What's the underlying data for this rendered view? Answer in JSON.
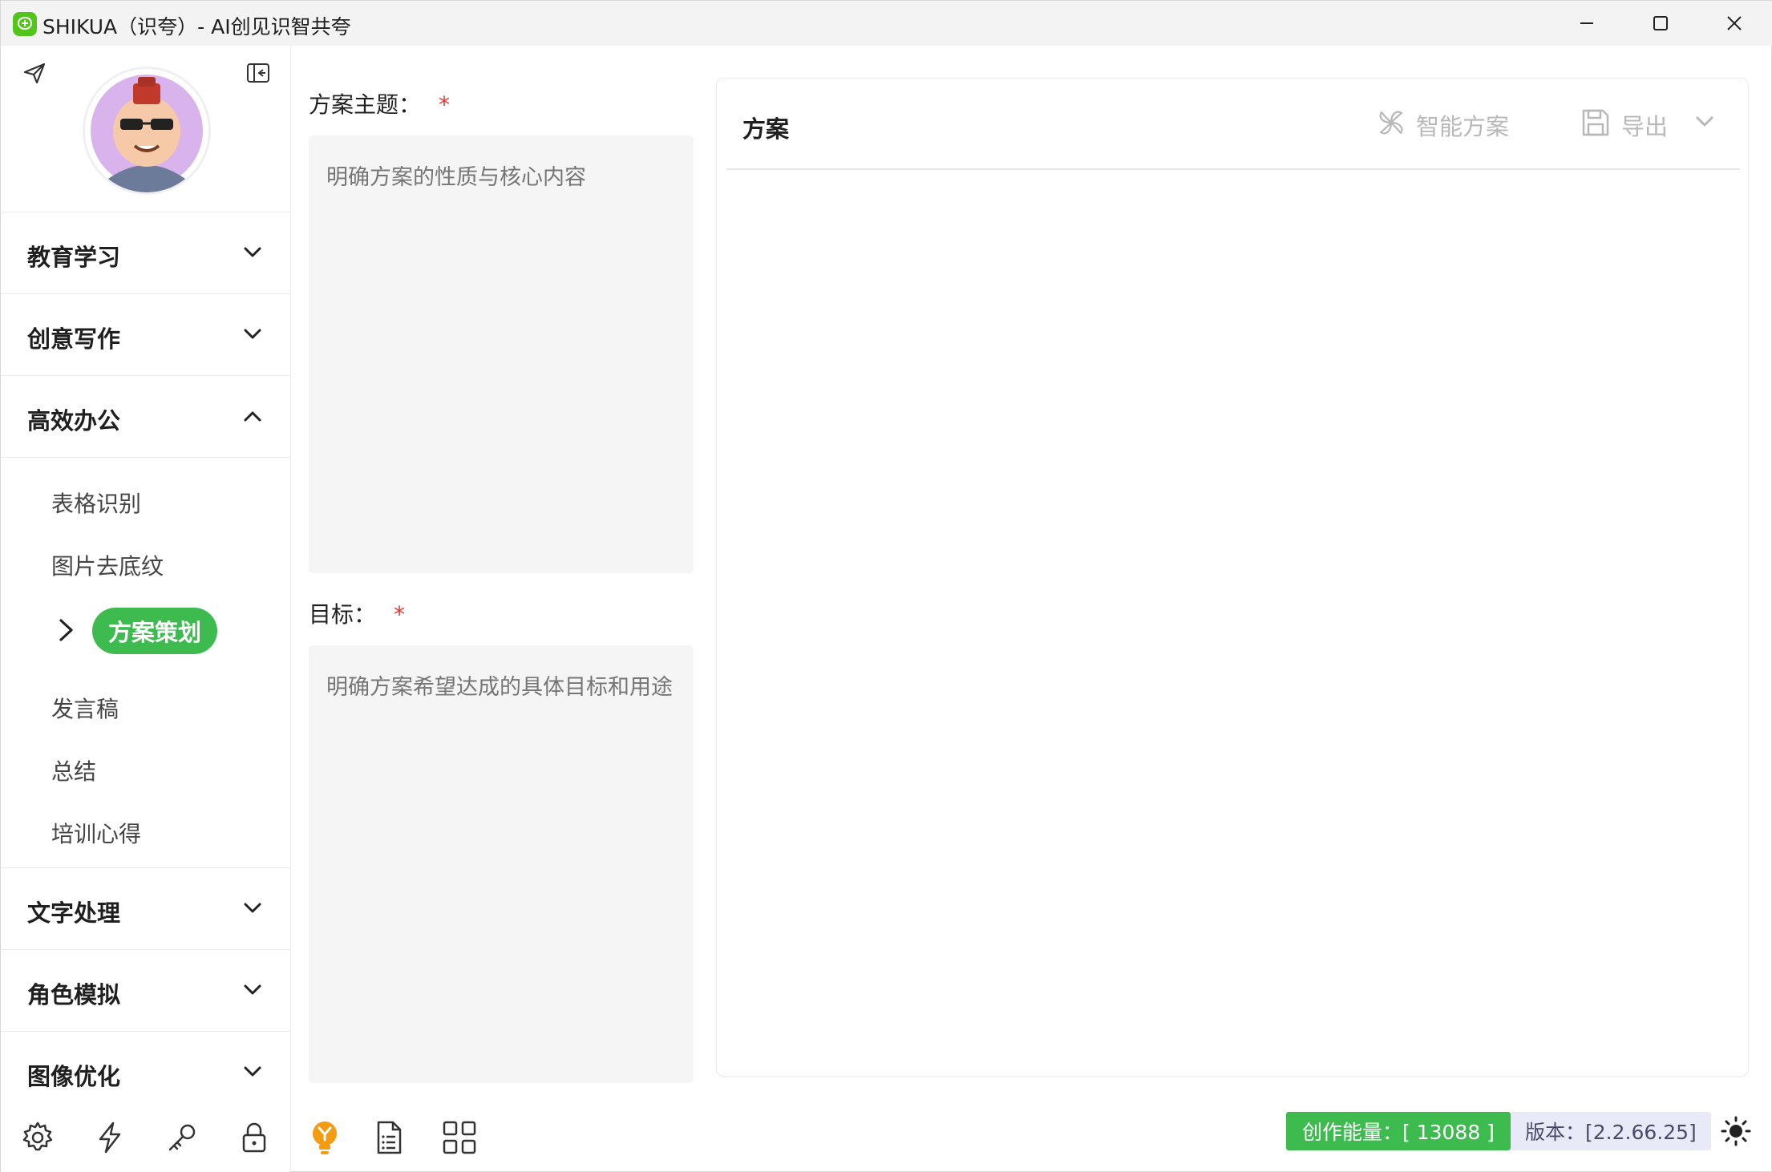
{
  "window": {
    "title": "SHIKUA（识夸）- AI创见识智共夸"
  },
  "sidebar": {
    "groups": [
      {
        "label": "教育学习",
        "expanded": false
      },
      {
        "label": "创意写作",
        "expanded": false
      },
      {
        "label": "高效办公",
        "expanded": true
      },
      {
        "label": "文字处理",
        "expanded": false
      },
      {
        "label": "角色模拟",
        "expanded": false
      },
      {
        "label": "图像优化",
        "expanded": false
      }
    ],
    "office_items": [
      "表格识别",
      "图片去底纹",
      "方案策划",
      "发言稿",
      "总结",
      "培训心得"
    ],
    "active_item": "方案策划",
    "bottom_icons": [
      "gear-icon",
      "lightning-icon",
      "key-icon",
      "lock-icon"
    ]
  },
  "form": {
    "topic": {
      "label": "方案主题：",
      "required": "*",
      "placeholder": "明确方案的性质与核心内容"
    },
    "goal": {
      "label": "目标：",
      "required": "*",
      "placeholder": "明确方案希望达成的具体目标和用途"
    },
    "tool_icons": [
      "lightbulb-icon",
      "document-icon",
      "grid-icon"
    ]
  },
  "panel": {
    "title": "方案",
    "smart_label": "智能方案",
    "export_label": "导出"
  },
  "status": {
    "energy": "创作能量：[ 13088 ]",
    "version": "版本：[2.2.66.25]"
  },
  "colors": {
    "accent_green": "#3dbb4f",
    "required_red": "#e53935",
    "version_bg": "#e8ebf7",
    "lightbulb_orange": "#f39c12"
  }
}
